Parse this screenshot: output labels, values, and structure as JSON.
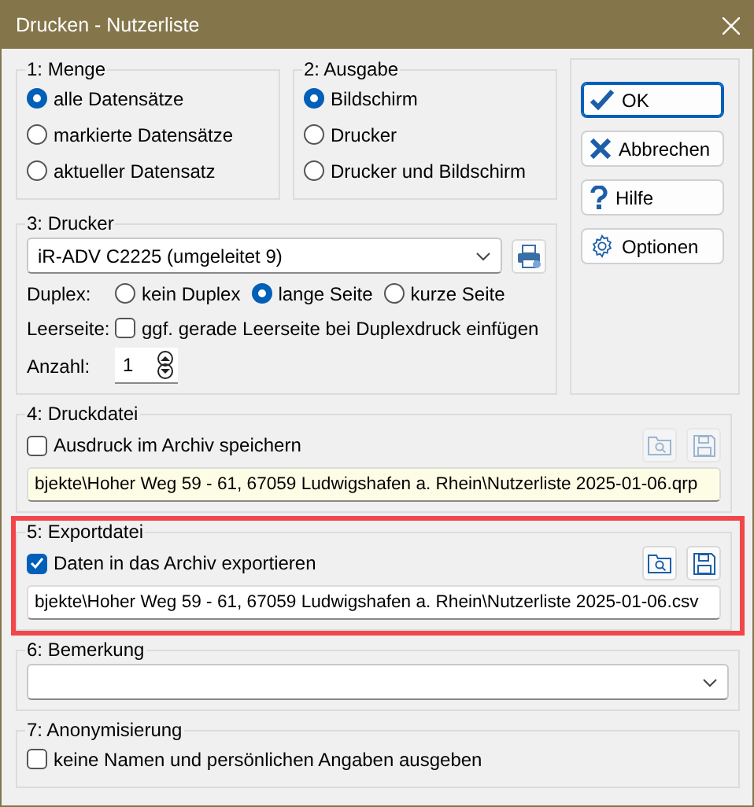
{
  "window": {
    "title": "Drucken - Nutzerliste"
  },
  "menge": {
    "title": "1: Menge",
    "options": [
      {
        "label": "alle Datensätze",
        "selected": true
      },
      {
        "label": "markierte Datensätze",
        "selected": false
      },
      {
        "label": "aktueller Datensatz",
        "selected": false
      }
    ]
  },
  "ausgabe": {
    "title": "2: Ausgabe",
    "options": [
      {
        "label": "Bildschirm",
        "selected": true
      },
      {
        "label": "Drucker",
        "selected": false
      },
      {
        "label": "Drucker und Bildschirm",
        "selected": false
      }
    ]
  },
  "buttons": [
    {
      "label": "OK",
      "kind": "check",
      "default": true
    },
    {
      "label": "Abbrechen",
      "kind": "cross",
      "default": false
    },
    {
      "label": "Hilfe",
      "kind": "help",
      "default": false
    },
    {
      "label": "Optionen",
      "kind": "gear",
      "default": false
    }
  ],
  "drucker": {
    "title": "3: Drucker",
    "printer": "iR-ADV C2225 (umgeleitet 9)",
    "duplex_label": "Duplex:",
    "duplex_options": [
      {
        "label": "kein Duplex",
        "selected": false
      },
      {
        "label": "lange Seite",
        "selected": true
      },
      {
        "label": "kurze Seite",
        "selected": false
      }
    ],
    "blank_label": "Leerseite:",
    "blank_option": {
      "label": "ggf. gerade Leerseite bei Duplexdruck einfügen",
      "checked": false
    },
    "copies_label": "Anzahl:",
    "copies": "1"
  },
  "files": [
    {
      "title": "4: Druckdatei",
      "checkbox": {
        "label": "Ausdruck im Archiv speichern",
        "checked": false
      },
      "path": "bjekte\\Hoher Weg 59 - 61, 67059 Ludwigshafen a. Rhein\\Nutzerliste 2025-01-06.qrp",
      "readonly": true,
      "highlighted": false
    },
    {
      "title": "5: Exportdatei",
      "checkbox": {
        "label": "Daten in das Archiv exportieren",
        "checked": true
      },
      "path": "bjekte\\Hoher Weg 59 - 61, 67059 Ludwigshafen a. Rhein\\Nutzerliste 2025-01-06.csv",
      "readonly": false,
      "highlighted": true
    }
  ],
  "bemerkung": {
    "title": "6: Bemerkung"
  },
  "anonymisierung": {
    "title": "7: Anonymisierung",
    "checkbox": {
      "label": "keine Namen und persönlichen Angaben ausgeben",
      "checked": false
    }
  }
}
